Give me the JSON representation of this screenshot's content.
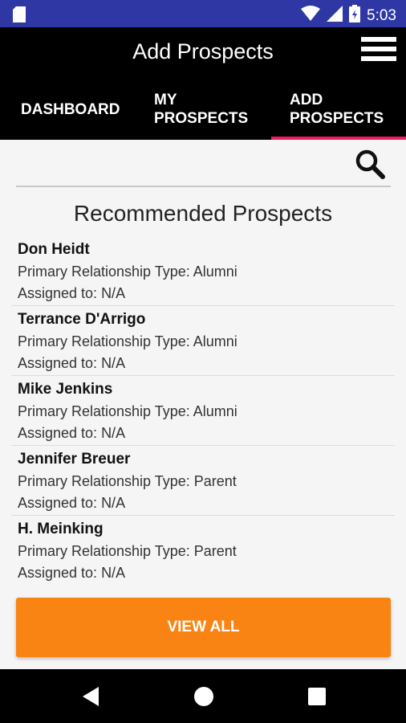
{
  "status_bar": {
    "time": "5:03",
    "icons": [
      "sd-card-icon",
      "wifi-icon",
      "signal-icon",
      "battery-icon"
    ]
  },
  "app_bar": {
    "title": "Add Prospects",
    "menu_icon": "hamburger-menu-icon"
  },
  "tabs": [
    {
      "label": "DASHBOARD"
    },
    {
      "label": "MY PROSPECTS"
    },
    {
      "label": "ADD PROSPECTS",
      "active": true
    }
  ],
  "accent_color": "#e91e63",
  "search": {
    "icon": "search-icon"
  },
  "section_title": "Recommended Prospects",
  "prospects": [
    {
      "name": "Don Heidt",
      "relationship": "Primary Relationship Type: Alumni",
      "assigned": "Assigned to: N/A"
    },
    {
      "name": "Terrance D'Arrigo",
      "relationship": "Primary Relationship Type: Alumni",
      "assigned": "Assigned to: N/A"
    },
    {
      "name": "Mike Jenkins",
      "relationship": "Primary Relationship Type: Alumni",
      "assigned": "Assigned to: N/A"
    },
    {
      "name": "Jennifer Breuer",
      "relationship": "Primary Relationship Type: Parent",
      "assigned": "Assigned to: N/A"
    },
    {
      "name": "H. Meinking",
      "relationship": "Primary Relationship Type: Parent",
      "assigned": "Assigned to: N/A"
    }
  ],
  "view_all_label": "VIEW ALL",
  "button_color": "#f98413",
  "nav_bar": {
    "icons": [
      "back-icon",
      "home-icon",
      "recents-icon"
    ]
  }
}
